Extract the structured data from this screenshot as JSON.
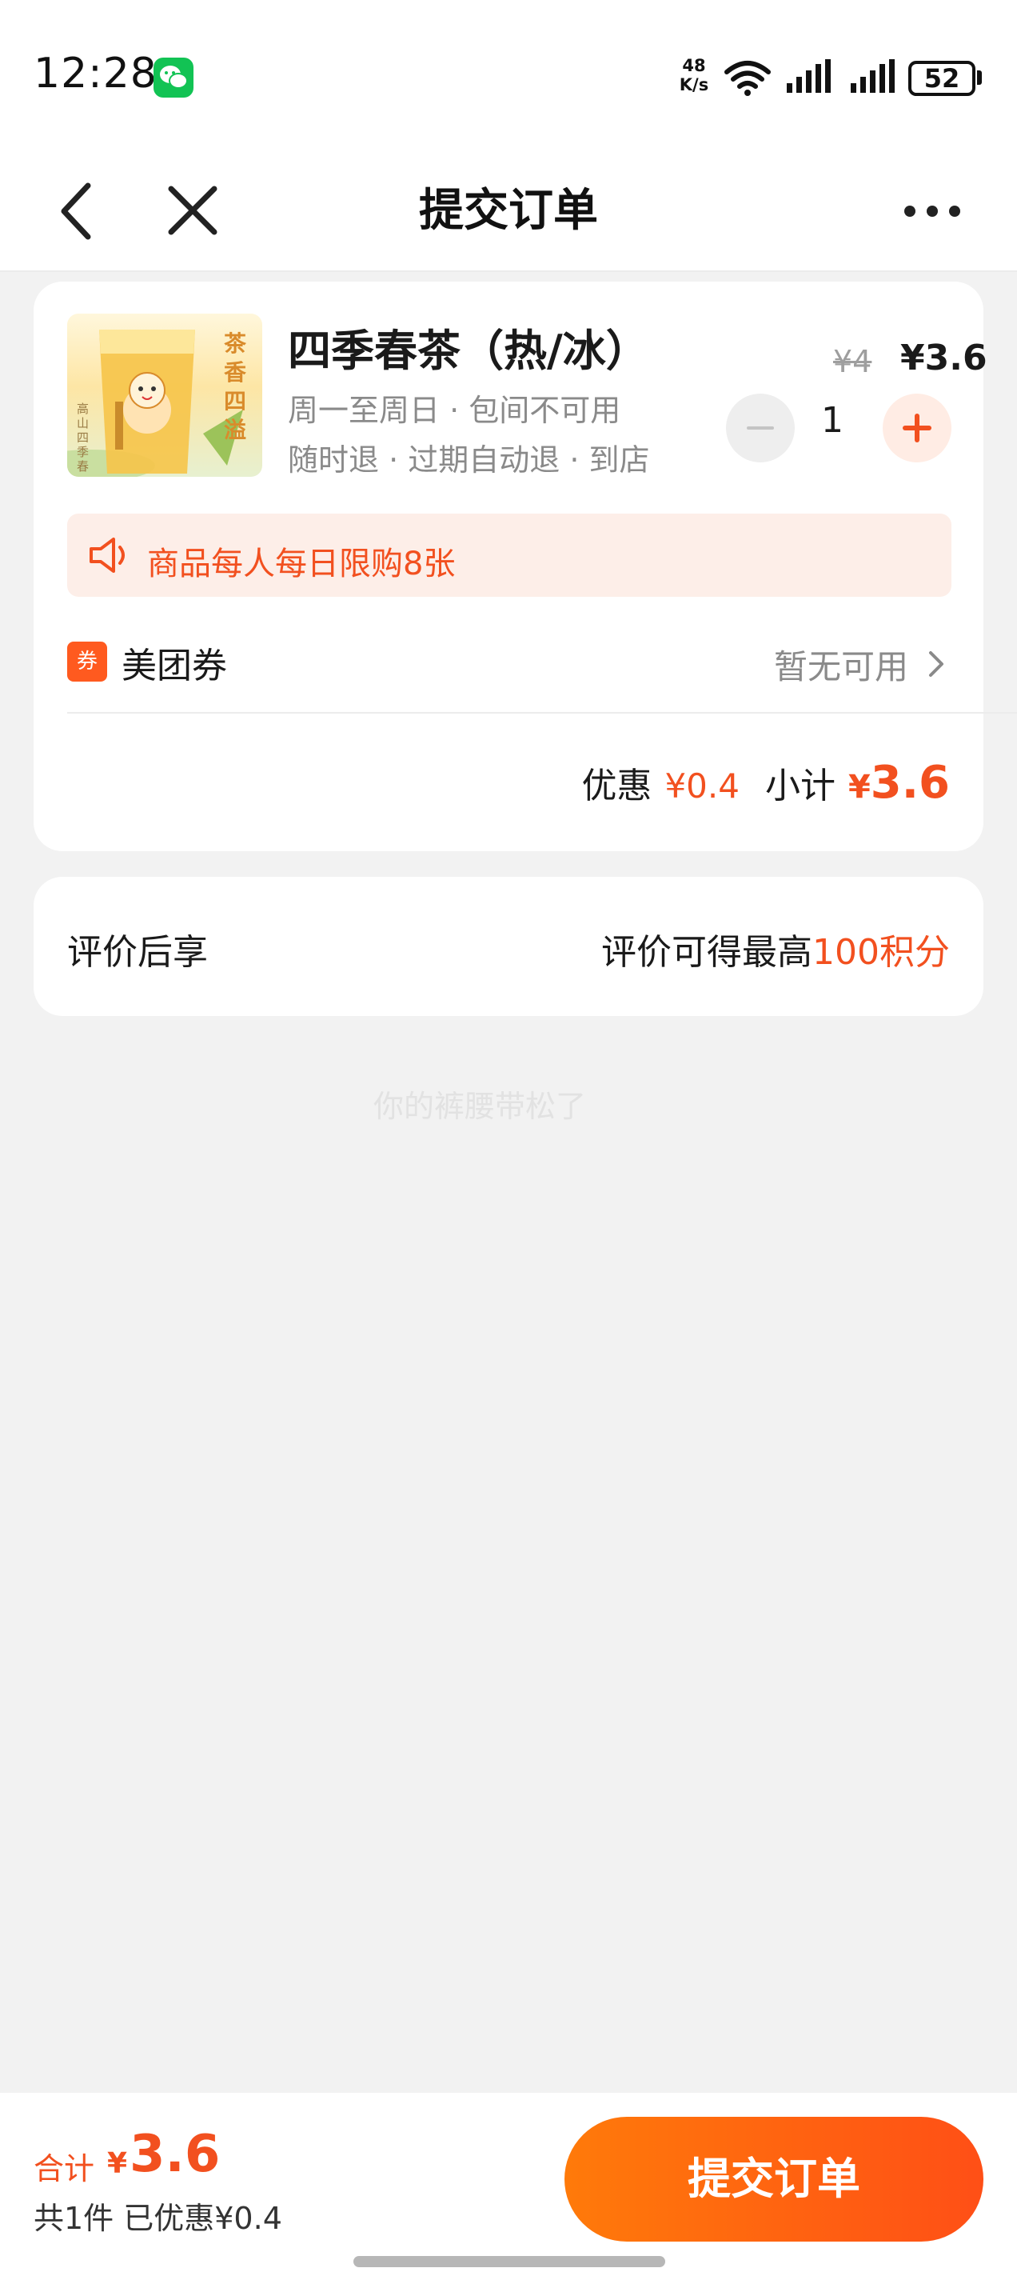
{
  "status_bar": {
    "time": "12:28",
    "net_speed_value": "48",
    "net_speed_unit": "K/s",
    "battery": "52",
    "app_icon": "wechat-icon"
  },
  "nav": {
    "title": "提交订单",
    "back_icon": "chevron-left-icon",
    "close_icon": "close-icon",
    "more_icon": "more-dots-icon"
  },
  "product": {
    "title": "四季春茶（热/冰）",
    "line1": "周一至周日 · 包间不可用",
    "line2": "随时退 · 过期自动退 · 到店",
    "image_text": "茶香四溢",
    "image_small_text": "高山四季春",
    "price_old": "¥4",
    "price_new": "¥3.6",
    "quantity": "1"
  },
  "notice": {
    "text": "商品每人每日限购8张"
  },
  "coupon": {
    "badge": "券",
    "label": "美团券",
    "value": "暂无可用"
  },
  "subtotal": {
    "discount_label": "优惠",
    "discount_value": "¥0.4",
    "subtotal_label": "小计",
    "currency": "¥",
    "total": "3.6"
  },
  "review": {
    "left": "评价后享",
    "right_prefix": "评价可得最高",
    "right_points": "100积分"
  },
  "watermark": "你的裤腰带松了",
  "bottom": {
    "total_label": "合计",
    "currency": "¥",
    "total_value": "3.6",
    "summary": "共1件  已优惠¥0.4",
    "submit_label": "提交订单"
  },
  "colors": {
    "accent": "#f2501f",
    "button_start": "#ff7a0a",
    "button_end": "#ff4f16",
    "background": "#f2f2f2"
  }
}
